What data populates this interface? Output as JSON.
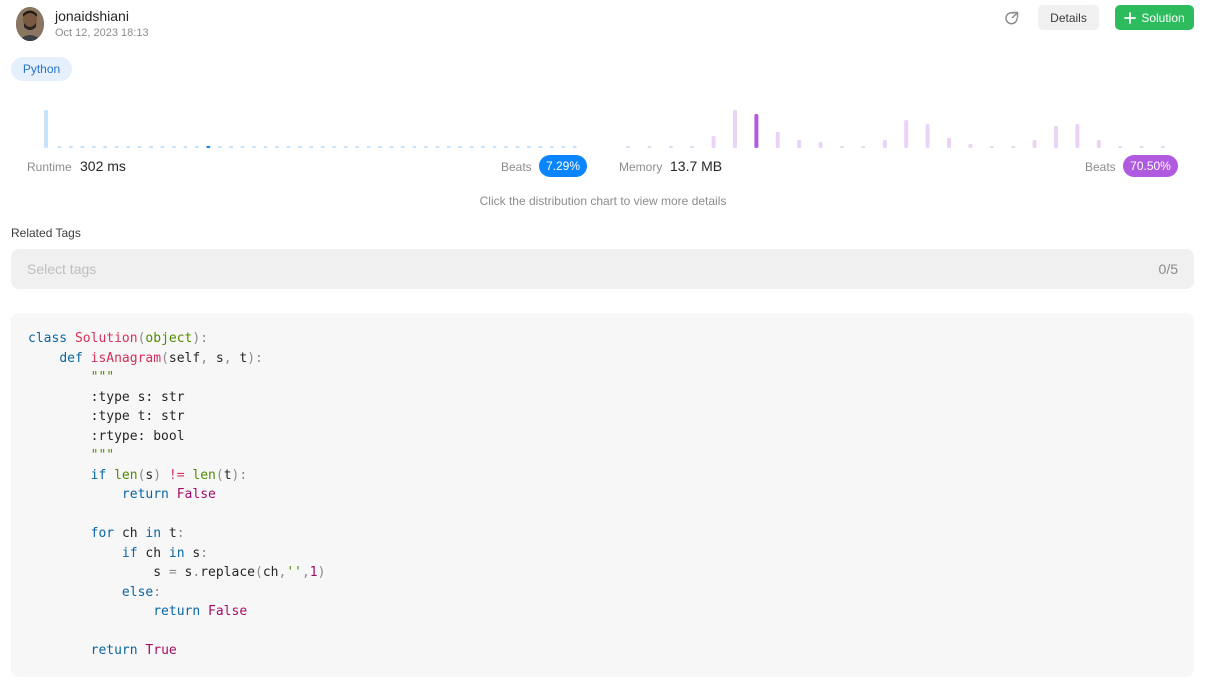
{
  "post": {
    "username": "jonaidshiani",
    "timestamp": "Oct 12, 2023 18:13"
  },
  "actions": {
    "details_label": "Details",
    "solution_label": "Solution",
    "share_icon": "share-icon",
    "plus_icon": "plus-icon"
  },
  "language": "Python",
  "runtime": {
    "label": "Runtime",
    "value": "302 ms",
    "beats_label": "Beats",
    "beats_value": "7.29%",
    "color": "#0a84ff"
  },
  "memory": {
    "label": "Memory",
    "value": "13.7 MB",
    "beats_label": "Beats",
    "beats_value": "70.50%",
    "color": "#b05ae0"
  },
  "chart_data": [
    {
      "type": "bar",
      "series": [
        {
          "values": [
            18,
            1,
            1,
            1,
            1,
            1,
            1,
            1,
            1,
            1,
            1,
            1,
            1,
            1,
            1,
            1,
            1,
            1,
            1,
            1,
            1,
            1,
            1,
            1,
            1,
            1,
            1,
            1,
            1,
            1,
            1,
            1,
            1,
            1,
            1,
            1,
            1,
            1,
            1,
            1,
            1,
            1,
            1,
            1,
            1,
            1,
            1
          ],
          "highlight_index": 14
        }
      ]
    },
    {
      "type": "bar",
      "series": [
        {
          "values": [
            1,
            1,
            1,
            1,
            6,
            19,
            17,
            8,
            4,
            3,
            1,
            1,
            4,
            14,
            12,
            5,
            2,
            1,
            1,
            4,
            11,
            12,
            4,
            1,
            1,
            1
          ],
          "highlight_index": 6
        }
      ]
    }
  ],
  "hint": "Click the distribution chart to view more details",
  "tags": {
    "title": "Related Tags",
    "placeholder": "Select tags",
    "count": "0/5"
  },
  "code": {
    "lines": [
      [
        [
          "kw",
          "class "
        ],
        [
          "cls",
          "Solution"
        ],
        [
          "pun",
          "("
        ],
        [
          "bi",
          "object"
        ],
        [
          "pun",
          "):"
        ]
      ],
      [
        [
          "",
          "    "
        ],
        [
          "kw",
          "def "
        ],
        [
          "fn",
          "isAnagram"
        ],
        [
          "pun",
          "("
        ],
        [
          "",
          "self"
        ],
        [
          "pun",
          ", "
        ],
        [
          "",
          "s"
        ],
        [
          "pun",
          ", "
        ],
        [
          "",
          "t"
        ],
        [
          "pun",
          "):"
        ]
      ],
      [
        [
          "",
          "        "
        ],
        [
          "str",
          "\"\"\""
        ]
      ],
      [
        [
          "",
          "        :type s: str"
        ]
      ],
      [
        [
          "",
          "        :type t: str"
        ]
      ],
      [
        [
          "",
          "        :rtype: bool"
        ]
      ],
      [
        [
          "",
          "        "
        ],
        [
          "str",
          "\"\"\""
        ]
      ],
      [
        [
          "",
          "        "
        ],
        [
          "kw",
          "if "
        ],
        [
          "bi",
          "len"
        ],
        [
          "pun",
          "("
        ],
        [
          "",
          "s"
        ],
        [
          "pun",
          ") "
        ],
        [
          "cls",
          "!="
        ],
        [
          "",
          ""
        ],
        [
          "pun",
          " "
        ],
        [
          "bi",
          "len"
        ],
        [
          "pun",
          "("
        ],
        [
          "",
          "t"
        ],
        [
          "pun",
          "):"
        ]
      ],
      [
        [
          "",
          "            "
        ],
        [
          "kw",
          "return "
        ],
        [
          "cst",
          "False"
        ]
      ],
      [
        [
          "",
          ""
        ]
      ],
      [
        [
          "",
          "        "
        ],
        [
          "kw",
          "for "
        ],
        [
          "",
          "ch "
        ],
        [
          "kw",
          "in "
        ],
        [
          "",
          "t"
        ],
        [
          "pun",
          ":"
        ]
      ],
      [
        [
          "",
          "            "
        ],
        [
          "kw",
          "if "
        ],
        [
          "",
          "ch "
        ],
        [
          "kw",
          "in "
        ],
        [
          "",
          "s"
        ],
        [
          "pun",
          ":"
        ]
      ],
      [
        [
          "",
          "                "
        ],
        [
          "",
          "s "
        ],
        [
          "pun",
          "= "
        ],
        [
          "",
          "s"
        ],
        [
          "pun",
          "."
        ],
        [
          "",
          "replace"
        ],
        [
          "pun",
          "("
        ],
        [
          "",
          "ch"
        ],
        [
          "pun",
          ","
        ],
        [
          "str",
          "''"
        ],
        [
          "pun",
          ","
        ],
        [
          "num",
          "1"
        ],
        [
          "pun",
          ")"
        ]
      ],
      [
        [
          "",
          "            "
        ],
        [
          "kw",
          "else"
        ],
        [
          "pun",
          ":"
        ]
      ],
      [
        [
          "",
          "                "
        ],
        [
          "kw",
          "return "
        ],
        [
          "cst",
          "False"
        ]
      ],
      [
        [
          "",
          ""
        ]
      ],
      [
        [
          "",
          "        "
        ],
        [
          "kw",
          "return "
        ],
        [
          "cst",
          "True"
        ]
      ]
    ]
  }
}
